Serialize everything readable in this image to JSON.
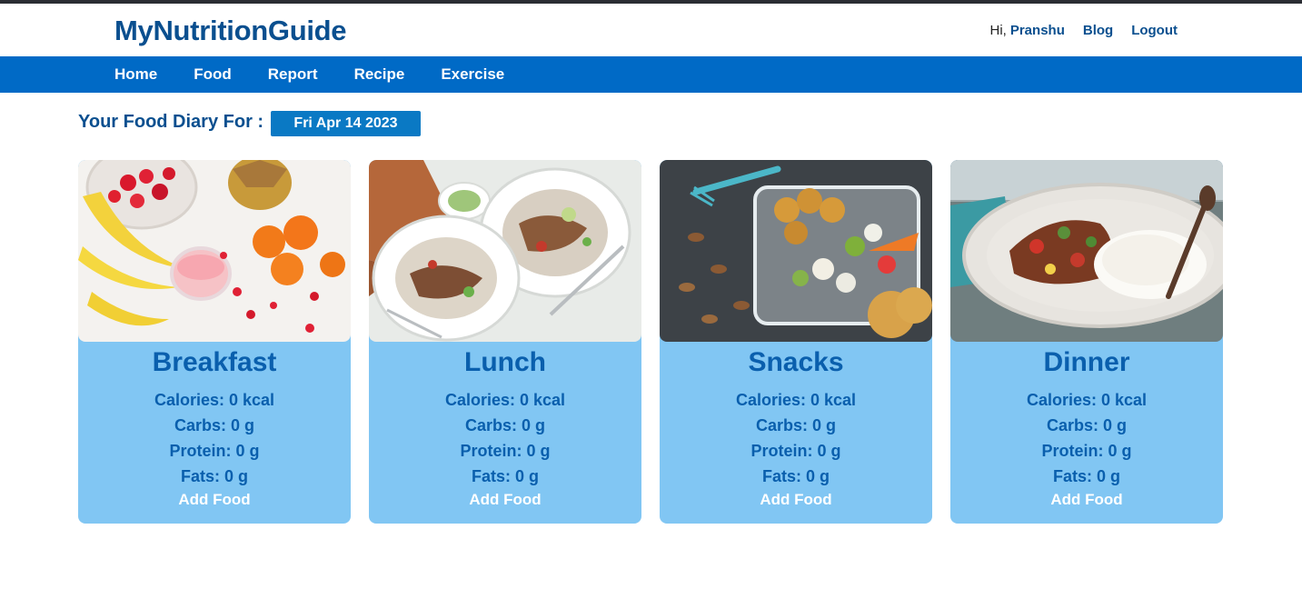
{
  "app": {
    "brand": "MyNutritionGuide",
    "greeting": "Hi,",
    "username": "Pranshu",
    "links": [
      "Blog",
      "Logout"
    ]
  },
  "nav": [
    "Home",
    "Food",
    "Report",
    "Recipe",
    "Exercise"
  ],
  "diary": {
    "title": "Your Food Diary For :",
    "date": "Fri Apr 14 2023"
  },
  "meals": [
    {
      "name": "Breakfast",
      "calories": "Calories: 0 kcal",
      "carbs": "Carbs: 0 g",
      "protein": "Protein: 0 g",
      "fats": "Fats: 0 g",
      "action": "Add Food",
      "image": "fruit-smoothie-photo"
    },
    {
      "name": "Lunch",
      "calories": "Calories: 0 kcal",
      "carbs": "Carbs: 0 g",
      "protein": "Protein: 0 g",
      "fats": "Fats: 0 g",
      "action": "Add Food",
      "image": "rice-salad-plates-photo"
    },
    {
      "name": "Snacks",
      "calories": "Calories: 0 kcal",
      "carbs": "Carbs: 0 g",
      "protein": "Protein: 0 g",
      "fats": "Fats: 0 g",
      "action": "Add Food",
      "image": "snack-box-photo"
    },
    {
      "name": "Dinner",
      "calories": "Calories: 0 kcal",
      "carbs": "Carbs: 0 g",
      "protein": "Protein: 0 g",
      "fats": "Fats: 0 g",
      "action": "Add Food",
      "image": "curry-rice-plate-photo"
    }
  ],
  "colors": {
    "brand": "#0a4f8f",
    "navbar": "#006ac6",
    "card": "#81c6f3",
    "date_badge": "#0a79c4"
  }
}
